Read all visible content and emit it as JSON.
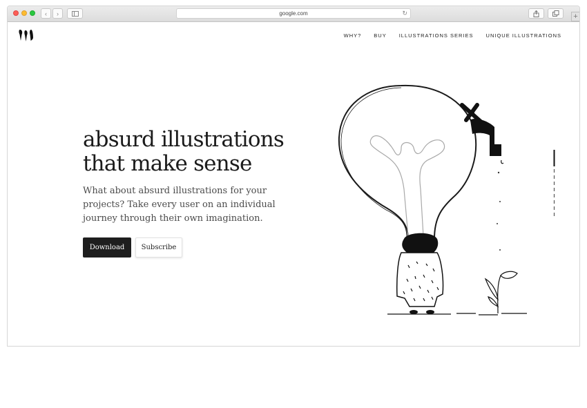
{
  "browser": {
    "url": "google.com",
    "back_icon": "chevron-left-icon",
    "forward_icon": "chevron-right-icon",
    "sidebar_icon": "sidebar-icon",
    "reload_icon": "reload-icon",
    "share_icon": "share-icon",
    "tabs_icon": "tabs-icon",
    "new_tab_icon": "plus-icon"
  },
  "nav": {
    "items": [
      {
        "label": "WHY?"
      },
      {
        "label": "BUY"
      },
      {
        "label": "ILLUSTRATIONS SERIES"
      },
      {
        "label": "UNIQUE ILLUSTRATIONS"
      }
    ]
  },
  "hero": {
    "title": "absurd illustrations that make sense",
    "subtitle": "What about absurd illustrations for your projects? Take every user on an individual journey through their own imagination.",
    "download_label": "Download",
    "subscribe_label": "Subscribe"
  },
  "colors": {
    "primary_button": "#1e1e1e",
    "text": "#1b1b1b",
    "accent": "#000000"
  }
}
